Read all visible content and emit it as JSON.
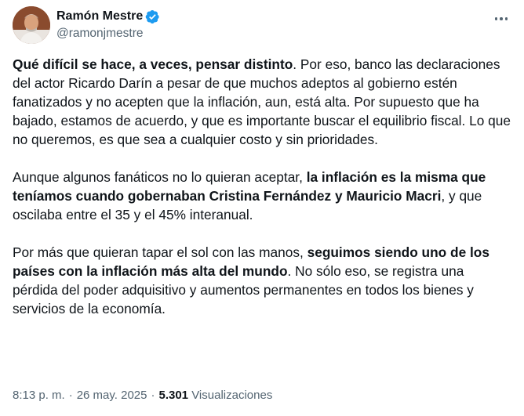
{
  "author": {
    "display_name": "Ramón Mestre",
    "handle": "@ramonjmestre",
    "verified": true,
    "avatar_icon": "profile-photo",
    "verified_color": "#1d9bf0"
  },
  "menu": {
    "icon": "more-horizontal-icon"
  },
  "tweet": {
    "p1": {
      "bold": "Qué difícil se hace, a veces, pensar distinto",
      "rest": ". Por eso, banco las declaraciones del actor Ricardo Darín a pesar de que muchos adeptos al gobierno estén fanatizados y no acepten que la inflación, aun, está alta. Por supuesto que ha bajado, estamos de acuerdo, y que es importante buscar el equilibrio fiscal. Lo que no queremos, es que sea a cualquier costo y sin prioridades."
    },
    "p2": {
      "pre": "Aunque algunos fanáticos no lo quieran aceptar, ",
      "bold": "la inflación es la misma que teníamos cuando gobernaban Cristina Fernández y Mauricio Macri",
      "post": ", y que oscilaba entre el 35 y el 45% interanual."
    },
    "p3": {
      "pre": "Por más que quieran tapar el sol con las manos, ",
      "bold": "seguimos siendo uno de los países con la inflación más alta del mundo",
      "post": ". No sólo eso, se registra una pérdida del poder adquisitivo y aumentos permanentes en todos los bienes y servicios de la economía."
    }
  },
  "meta": {
    "time": "8:13 p. m.",
    "separator": "·",
    "date": "26 may. 2025",
    "views_count": "5.301",
    "views_label": "Visualizaciones"
  }
}
